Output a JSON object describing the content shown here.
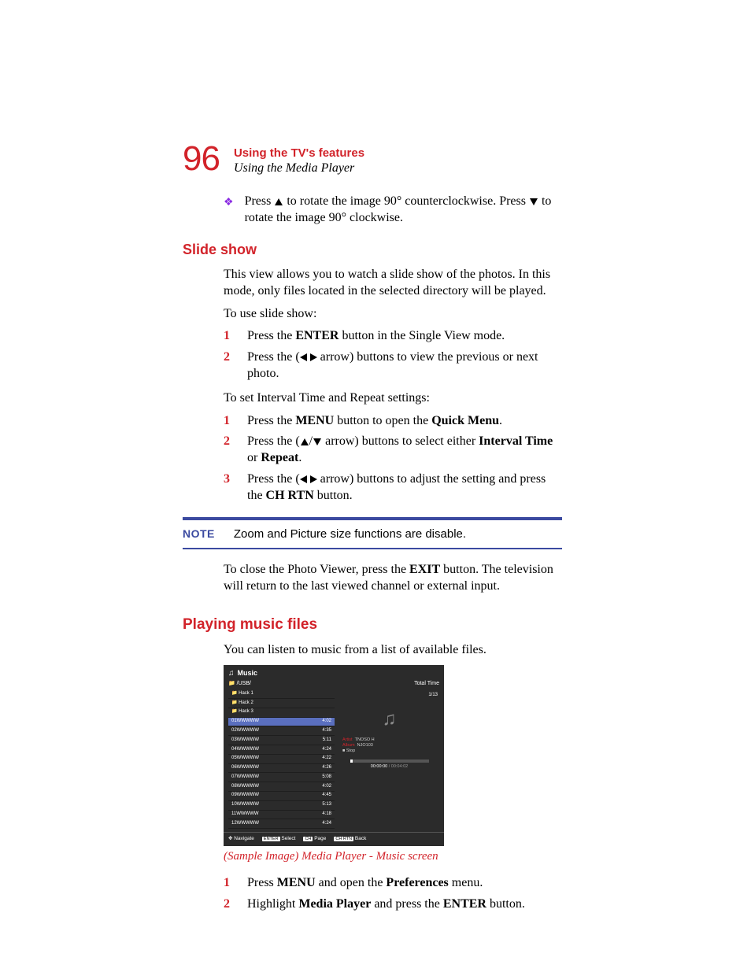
{
  "header": {
    "page_number": "96",
    "chapter": "Using the TV's features",
    "section": "Using the Media Player"
  },
  "bullet1": {
    "part1": "Press ",
    "part2": " to rotate the image 90° counterclockwise. Press ",
    "part3": " to rotate the image 90° clockwise."
  },
  "slideshow": {
    "heading": "Slide show",
    "intro": "This view allows you to watch a slide show of the photos. In this mode, only files located in the selected directory will be played.",
    "use_label": "To use slide show:",
    "steps_use": [
      {
        "pre": "Press the ",
        "b1": "ENTER",
        "post": " button in the Single View mode."
      },
      {
        "pre": "Press the (",
        "post": " arrow) buttons to view the previous or next photo.",
        "arrows": "lr"
      }
    ],
    "set_label": "To set Interval Time and Repeat settings:",
    "steps_set": [
      {
        "pre": "Press the ",
        "b1": "MENU",
        "mid": " button to open the ",
        "b2": "Quick Menu",
        "post": "."
      },
      {
        "pre": "Press the (",
        "mid": " arrow) buttons to select either ",
        "b1": "Interval Time",
        "mid2": " or ",
        "b2": "Repeat",
        "post": ".",
        "arrows": "ud"
      },
      {
        "pre": "Press the (",
        "mid": " arrow) buttons to adjust the setting and press the ",
        "b1": "CH RTN",
        "post": " button.",
        "arrows": "lr"
      }
    ]
  },
  "note": {
    "label": "NOTE",
    "text": "Zoom and Picture size functions are disable."
  },
  "close_para": {
    "pre": "To close the Photo Viewer, press the ",
    "b1": "EXIT",
    "post": " button. The television will return to the last viewed channel or external input."
  },
  "playing": {
    "heading": "Playing music files",
    "intro": "You can listen to music from a list of available files.",
    "caption": "(Sample Image) Media Player - Music screen",
    "steps": [
      {
        "pre": "Press ",
        "b1": "MENU",
        "mid": " and open the ",
        "b2": "Preferences",
        "post": " menu."
      },
      {
        "pre": "Highlight ",
        "b1": "Media Player",
        "mid": " and press the ",
        "b2": "ENTER",
        "post": " button."
      }
    ]
  },
  "music_screen": {
    "title": "Music",
    "path": "/USB/",
    "total_time_label": "Total Time",
    "rows": [
      {
        "name": "Hack 1",
        "time": ""
      },
      {
        "name": "Hack 2",
        "time": ""
      },
      {
        "name": "Hack 3",
        "time": ""
      },
      {
        "name": "01WWWWW",
        "time": "4:02"
      },
      {
        "name": "02WWWWW",
        "time": "4:35"
      },
      {
        "name": "03WWWWW",
        "time": "5:11"
      },
      {
        "name": "04WWWWW",
        "time": "4:24"
      },
      {
        "name": "05WWWWW",
        "time": "4:22"
      },
      {
        "name": "06WWWWW",
        "time": "4:26"
      },
      {
        "name": "07WWWWW",
        "time": "5:08"
      },
      {
        "name": "08WWWWW",
        "time": "4:02"
      },
      {
        "name": "09WWWWW",
        "time": "4:45"
      },
      {
        "name": "10WWWWW",
        "time": "5:13"
      },
      {
        "name": "11WWWWW",
        "time": "4:18"
      },
      {
        "name": "12WWWWW",
        "time": "4:24"
      }
    ],
    "selected_index": 3,
    "counter": "1/13",
    "meta": {
      "artist_label": "Artist",
      "artist": "TNOSO H",
      "album_label": "Album",
      "album": "NJO103",
      "status": "Stop"
    },
    "time_current": "00:00:00",
    "time_total": "/ 00:04:02",
    "footer": {
      "navigate": "Navigate",
      "enter_key": "ENTER",
      "select": "Select",
      "ch_key": "CH",
      "page": "Page",
      "chrtn_key": "CH RTN",
      "back": "Back"
    }
  }
}
